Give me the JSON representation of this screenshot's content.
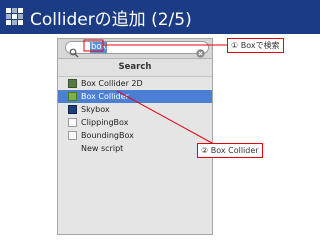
{
  "header": {
    "title": "Colliderの追加 (2/5)"
  },
  "search": {
    "value": "box"
  },
  "section": {
    "label": "Search"
  },
  "results": [
    {
      "label": "Box Collider 2D",
      "icon": "box-collider-2d-icon"
    },
    {
      "label": "Box Collider",
      "icon": "box-collider-icon",
      "selected": true
    },
    {
      "label": "Skybox",
      "icon": "skybox-icon"
    },
    {
      "label": "ClippingBox",
      "icon": "script-icon"
    },
    {
      "label": "BoundingBox",
      "icon": "script-icon"
    },
    {
      "label": "New script",
      "icon": ""
    }
  ],
  "callouts": {
    "search": "① Boxで検索",
    "select": "② Box Collider"
  },
  "colors": {
    "header": "#1b3c84",
    "selection": "#4a7fd4",
    "callout_border": "#e3000f"
  }
}
